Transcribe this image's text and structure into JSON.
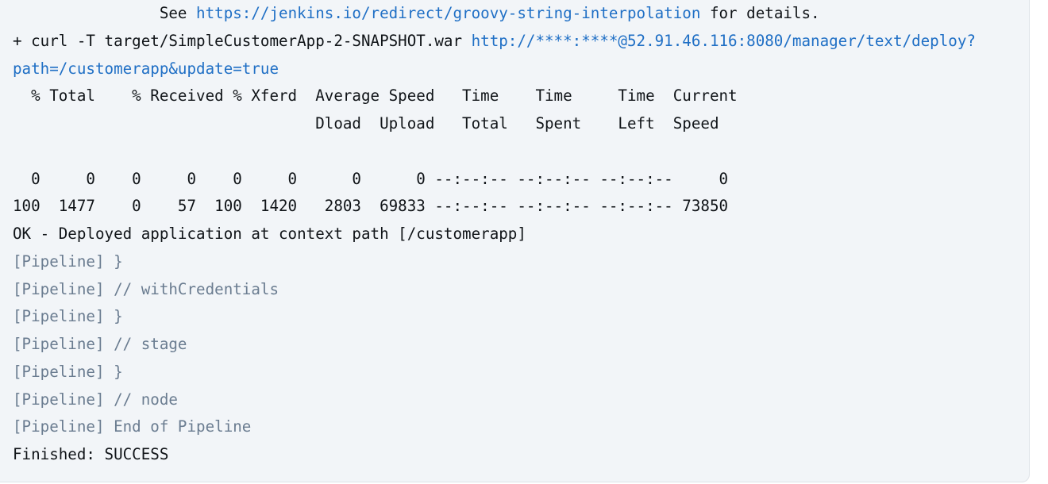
{
  "console": {
    "lines": [
      {
        "type": "mixed",
        "prefix": "                See ",
        "link": "https://jenkins.io/redirect/groovy-string-interpolation",
        "suffix": " for details."
      },
      {
        "type": "mixed",
        "prefix": "+ curl -T target/SimpleCustomerApp-2-SNAPSHOT.war ",
        "link": "http://****:****@52.91.46.116:8080/manager/text/deploy?",
        "suffix": ""
      },
      {
        "type": "link",
        "text": "path=/customerapp&update=true"
      },
      {
        "type": "plain",
        "text": "  % Total    % Received % Xferd  Average Speed   Time    Time     Time  Current"
      },
      {
        "type": "plain",
        "text": "                                 Dload  Upload   Total   Spent    Left  Speed"
      },
      {
        "type": "plain",
        "text": ""
      },
      {
        "type": "plain",
        "text": "  0     0    0     0    0     0      0      0 --:--:-- --:--:-- --:--:--     0"
      },
      {
        "type": "plain",
        "text": "100  1477    0    57  100  1420   2803  69833 --:--:-- --:--:-- --:--:-- 73850"
      },
      {
        "type": "plain",
        "text": "OK - Deployed application at context path [/customerapp]"
      },
      {
        "type": "pipeline",
        "text": "[Pipeline] }"
      },
      {
        "type": "pipeline",
        "text": "[Pipeline] // withCredentials"
      },
      {
        "type": "pipeline",
        "text": "[Pipeline] }"
      },
      {
        "type": "pipeline",
        "text": "[Pipeline] // stage"
      },
      {
        "type": "pipeline",
        "text": "[Pipeline] }"
      },
      {
        "type": "pipeline",
        "text": "[Pipeline] // node"
      },
      {
        "type": "pipeline",
        "text": "[Pipeline] End of Pipeline"
      },
      {
        "type": "plain",
        "text": "Finished: SUCCESS"
      }
    ]
  },
  "colors": {
    "background": "#f2f5f8",
    "text": "#101418",
    "link": "#1f6fc5",
    "pipeline": "#6a7c90"
  }
}
